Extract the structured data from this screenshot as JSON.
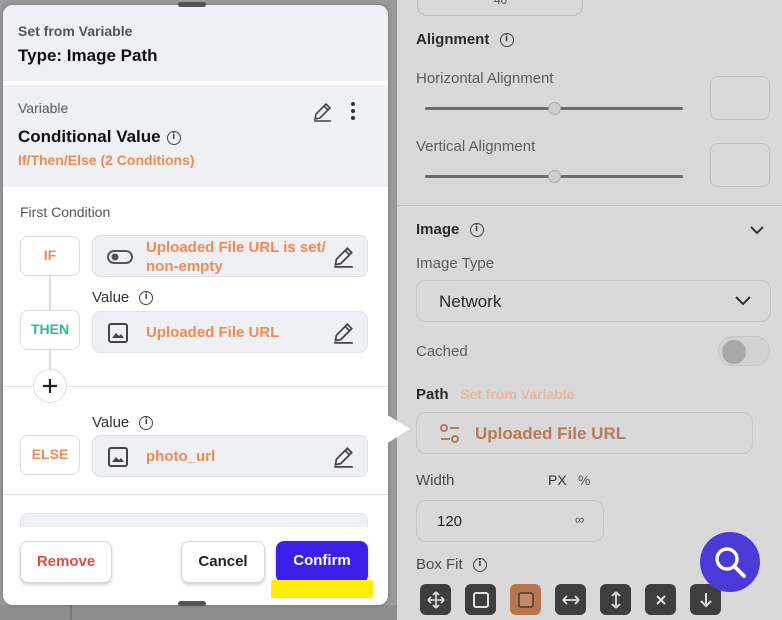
{
  "dialog": {
    "subtitle": "Set from Variable",
    "title": "Type: Image Path",
    "variable_label": "Variable",
    "variable_value": "Conditional Value",
    "condition_summary": "If/Then/Else (2 Conditions)",
    "first_condition_label": "First Condition",
    "if_tag": "IF",
    "if_value_line1": "Uploaded File URL is set/",
    "if_value_line2": "non-empty",
    "then_tag": "THEN",
    "then_value_label": "Value",
    "then_value": "Uploaded File URL",
    "else_tag": "ELSE",
    "else_value_label": "Value",
    "else_value": "photo_url",
    "remove_label": "Remove",
    "cancel_label": "Cancel",
    "confirm_label": "Confirm"
  },
  "properties": {
    "top_value": "40",
    "alignment_title": "Alignment",
    "horizontal_label": "Horizontal Alignment",
    "vertical_label": "Vertical Alignment",
    "horizontal_level": 0.5,
    "vertical_level": 0.5,
    "image_title": "Image",
    "image_type_label": "Image Type",
    "image_type_value": "Network",
    "cached_label": "Cached",
    "cached_on": false,
    "path_label": "Path",
    "path_hint": "Set from Variable",
    "path_value": "Uploaded File URL",
    "width_label": "Width",
    "width_unit_px": "PX",
    "width_unit_pct": "%",
    "width_value": "120",
    "width_max": "∞",
    "box_fit_label": "Box Fit"
  },
  "colors": {
    "accent_orange": "#ee8a55",
    "then_green": "#2eb89a",
    "confirm_blue": "#3a20e8",
    "remove_red": "#e24a43",
    "highlight": "#ffee00",
    "fab": "#4a3bd6"
  },
  "icons": [
    "info-icon",
    "pencil-icon",
    "more-vertical-icon",
    "toggle-icon",
    "image-icon",
    "plus-icon",
    "chevron-down-icon",
    "variable-icon",
    "search-icon"
  ]
}
